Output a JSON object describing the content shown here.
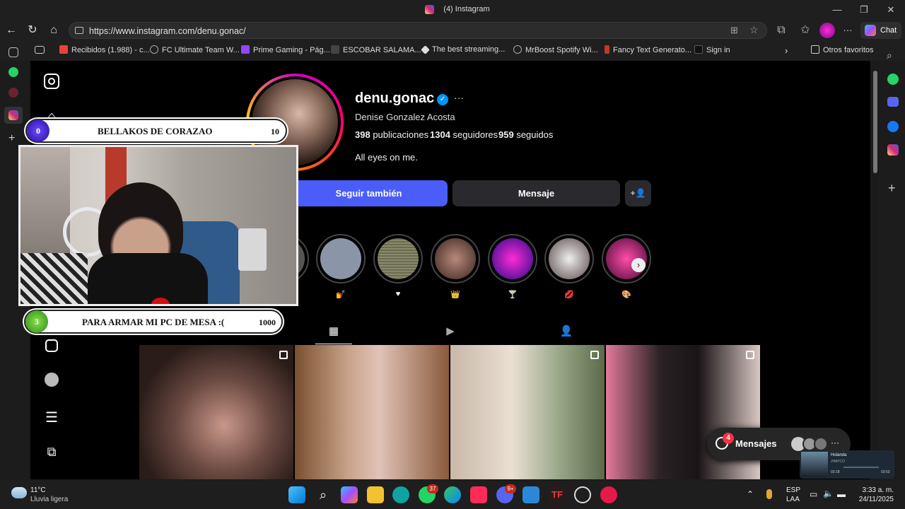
{
  "window": {
    "title": "(4) Instagram",
    "minimize": "—",
    "maximize": "❐",
    "close": "✕"
  },
  "nav": {
    "url": "https://www.instagram.com/denu.gonac/",
    "chat_label": "Chat"
  },
  "bookmarks": [
    {
      "label": "Recibidos (1.988) - c...",
      "color": "#ea4335"
    },
    {
      "label": "FC Ultimate Team W...",
      "color": "#888888"
    },
    {
      "label": "Prime Gaming - Pág...",
      "color": "#9146ff"
    },
    {
      "label": "ESCOBAR SALAMA...",
      "color": "#444444"
    },
    {
      "label": "The best streaming...",
      "color": "#dddddd"
    },
    {
      "label": "MrBoost Spotify Wi...",
      "color": "#888888"
    },
    {
      "label": "Fancy Text Generato...",
      "color": "#c0392b"
    },
    {
      "label": "Sign in",
      "color": "#222222"
    }
  ],
  "bookmarks_more": "Otros favoritos",
  "profile": {
    "username": "denu.gonac",
    "verified": "✓",
    "more": "···",
    "full_name": "Denise Gonzalez Acosta",
    "posts_count": "398",
    "posts_label": "publicaciones",
    "followers_count": "1304",
    "followers_label": "seguidores",
    "following_count": "959",
    "following_label": "seguidos",
    "bio": "All eyes on me.",
    "follow_button": "Seguir también",
    "message_button": "Mensaje",
    "add_user_icon": "+👤"
  },
  "highlights": [
    {
      "label": "",
      "color": "#555555"
    },
    {
      "label": "💅",
      "color": "#8a96a8"
    },
    {
      "label": "♥",
      "color": "#6b6b52"
    },
    {
      "label": "👑",
      "color": "#6e4d43"
    },
    {
      "label": "🍸",
      "color": "#4b1aa3"
    },
    {
      "label": "💋",
      "color": "#7a7070"
    },
    {
      "label": "🎨",
      "color": "#9b2b62"
    }
  ],
  "highlights_next": "›",
  "tabs": [
    "▦",
    "▶",
    "👤"
  ],
  "messages": {
    "label": "Mensajes",
    "badge": "4"
  },
  "overlay_top": {
    "left_num": "0",
    "title": "BELLAKOS DE CORAZAO",
    "right_num": "10"
  },
  "overlay_bottom": {
    "left_num": "3",
    "title": "PARA ARMAR MI PC DE MESA :(",
    "right_num": "1000"
  },
  "media_widget": {
    "title": "Holanda",
    "artist": "JHAYCO",
    "time_left": "03:18",
    "time_right": "03:53"
  },
  "taskbar": {
    "weather_temp": "11°C",
    "weather_desc": "Lluvia ligera",
    "whatsapp_badge": "37",
    "discord_badge": "9+",
    "lang_1": "ESP",
    "lang_2": "LAA",
    "time": "3:33 a. m.",
    "date": "24/11/2025"
  }
}
